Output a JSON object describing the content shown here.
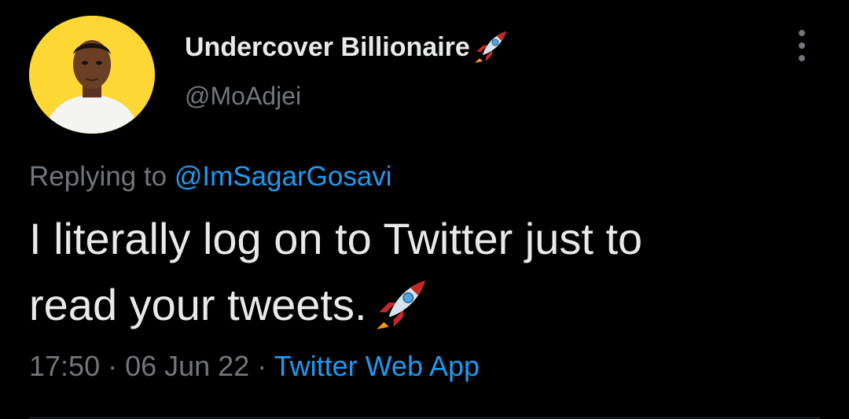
{
  "author": {
    "display_name": "Undercover Billionaire",
    "name_emoji": "rocket-icon",
    "handle": "@MoAdjei",
    "avatar_background": "#fdd835"
  },
  "reply": {
    "prefix": "Replying to ",
    "mention": "@ImSagarGosavi"
  },
  "tweet": {
    "text_line1": "I literally log on to Twitter just to",
    "text_line2": "read your tweets.",
    "emoji": "rocket-icon"
  },
  "meta": {
    "time": "17:50",
    "separator": " · ",
    "date": "06 Jun 22",
    "source": "Twitter Web App"
  },
  "colors": {
    "background": "#000000",
    "text": "#e7e9ea",
    "muted": "#71767b",
    "link": "#1d9bf0"
  }
}
